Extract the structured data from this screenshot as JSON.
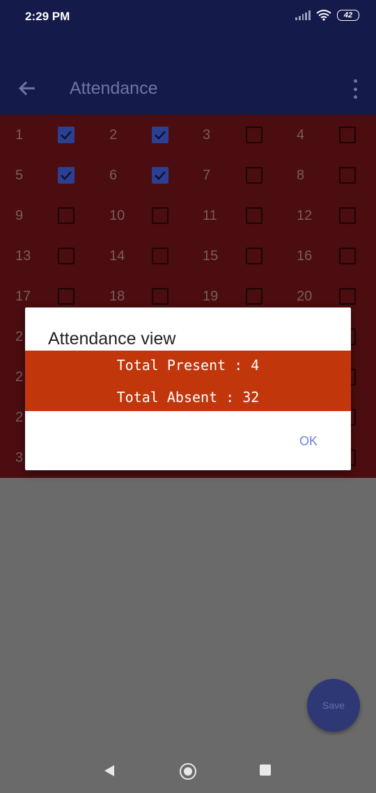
{
  "status_bar": {
    "time": "2:29 PM",
    "battery": "42"
  },
  "app_bar": {
    "title": "Attendance"
  },
  "grid": {
    "rows": [
      [
        {
          "num": "1",
          "checked": true
        },
        {
          "num": "2",
          "checked": true
        },
        {
          "num": "3",
          "checked": false
        },
        {
          "num": "4",
          "checked": false
        }
      ],
      [
        {
          "num": "5",
          "checked": true
        },
        {
          "num": "6",
          "checked": true
        },
        {
          "num": "7",
          "checked": false
        },
        {
          "num": "8",
          "checked": false
        }
      ],
      [
        {
          "num": "9",
          "checked": false
        },
        {
          "num": "10",
          "checked": false
        },
        {
          "num": "11",
          "checked": false
        },
        {
          "num": "12",
          "checked": false
        }
      ],
      [
        {
          "num": "13",
          "checked": false
        },
        {
          "num": "14",
          "checked": false
        },
        {
          "num": "15",
          "checked": false
        },
        {
          "num": "16",
          "checked": false
        }
      ],
      [
        {
          "num": "17",
          "checked": false
        },
        {
          "num": "18",
          "checked": false
        },
        {
          "num": "19",
          "checked": false
        },
        {
          "num": "20",
          "checked": false
        }
      ],
      [
        {
          "num": "2",
          "checked": false
        },
        {
          "num": "",
          "checked": false
        },
        {
          "num": "",
          "checked": false
        },
        {
          "num": "",
          "checked": false
        }
      ],
      [
        {
          "num": "2",
          "checked": false
        },
        {
          "num": "",
          "checked": false
        },
        {
          "num": "",
          "checked": false
        },
        {
          "num": "",
          "checked": false
        }
      ],
      [
        {
          "num": "2",
          "checked": false
        },
        {
          "num": "",
          "checked": false
        },
        {
          "num": "",
          "checked": false
        },
        {
          "num": "",
          "checked": false
        }
      ],
      [
        {
          "num": "3",
          "checked": false
        },
        {
          "num": "",
          "checked": false
        },
        {
          "num": "",
          "checked": false
        },
        {
          "num": "",
          "checked": false
        }
      ]
    ]
  },
  "dialog": {
    "title": "Attendance view",
    "present_line": "Total Present : 4",
    "absent_line": "Total Absent : 32",
    "ok_label": "OK"
  },
  "fab": {
    "label": "Save"
  },
  "icons": {
    "back": "arrow-left-icon",
    "menu": "more-vert-icon",
    "nav_back": "triangle-left-icon",
    "nav_home": "circle-icon",
    "nav_recent": "square-icon"
  },
  "colors": {
    "app_bar": "#141a49",
    "grid_bg": "#4b0d0f",
    "dialog_body": "#c2360c",
    "accent": "#6f7fe0"
  }
}
